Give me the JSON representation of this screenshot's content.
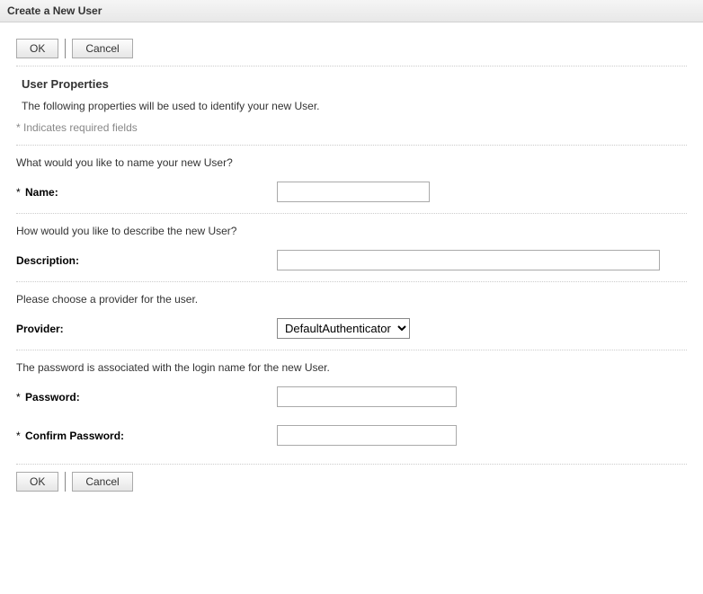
{
  "title": "Create a New User",
  "buttons": {
    "ok": "OK",
    "cancel": "Cancel"
  },
  "section": {
    "title": "User Properties",
    "desc": "The following properties will be used to identify your new User.",
    "required_note": "* Indicates required fields"
  },
  "fields": {
    "name": {
      "prompt": "What would you like to name your new User?",
      "label": "Name:",
      "required": "*",
      "value": ""
    },
    "description": {
      "prompt": "How would you like to describe the new User?",
      "label": "Description:",
      "value": ""
    },
    "provider": {
      "prompt": "Please choose a provider for the user.",
      "label": "Provider:",
      "selected": "DefaultAuthenticator"
    },
    "password": {
      "prompt": "The password is associated with the login name for the new User.",
      "label": "Password:",
      "required": "*",
      "value": ""
    },
    "confirm_password": {
      "label": "Confirm Password:",
      "required": "*",
      "value": ""
    }
  }
}
